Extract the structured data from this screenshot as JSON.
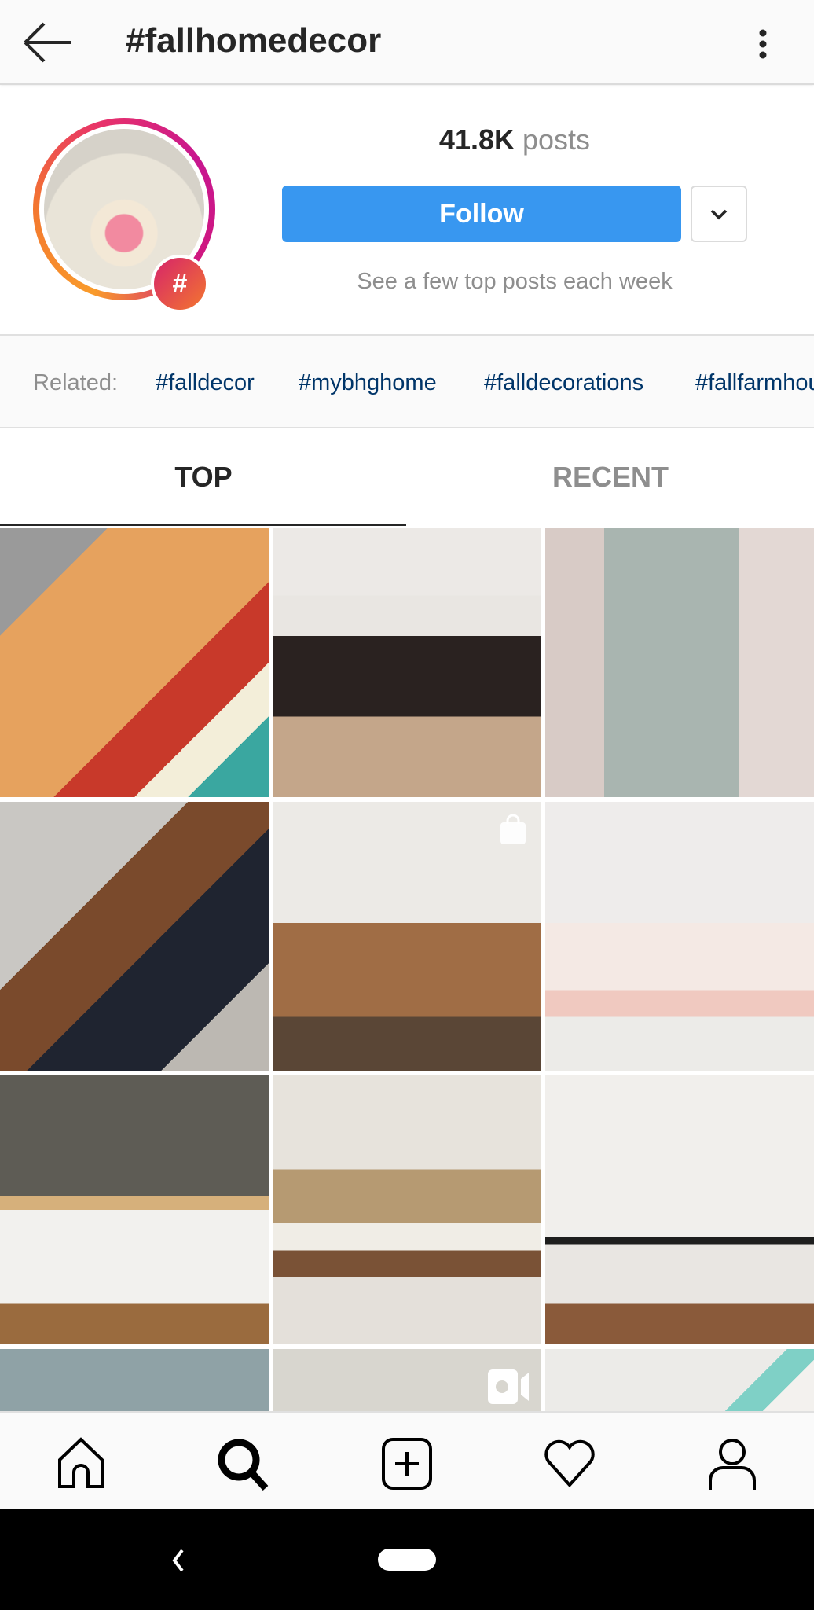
{
  "header": {
    "title": "#fallhomedecor",
    "back_icon": "arrow-left-icon",
    "more_icon": "more-vertical-icon"
  },
  "profile": {
    "posts_count": "41.8K",
    "posts_label": "posts",
    "follow_label": "Follow",
    "hint": "See a few top posts each week",
    "badge": "#",
    "accent": "#3897f0"
  },
  "related": {
    "label": "Related:",
    "tags": [
      "#falldecor",
      "#mybhghome",
      "#falldecorations",
      "#fallfarmhouse"
    ]
  },
  "tabs": [
    {
      "label": "TOP",
      "active": true
    },
    {
      "label": "RECENT",
      "active": false
    }
  ],
  "grid": [
    {
      "desc": "cat-on-blanket",
      "overlay": ""
    },
    {
      "desc": "fireplace-thankful",
      "overlay": ""
    },
    {
      "desc": "front-door-wreath",
      "overlay": ""
    },
    {
      "desc": "woman-porch-lanterns",
      "overlay": ""
    },
    {
      "desc": "apple-orchard-dining",
      "overlay": "shopping-bag-icon"
    },
    {
      "desc": "hammock-kids-corner",
      "overlay": ""
    },
    {
      "desc": "mantel-pumpkins",
      "overlay": ""
    },
    {
      "desc": "clock-console-pumpkins",
      "overlay": ""
    },
    {
      "desc": "kitchen-island",
      "overlay": ""
    },
    {
      "desc": "candy-jars-leaves",
      "overlay": ""
    },
    {
      "desc": "woman-portrait",
      "overlay": "igtv-video-icon"
    },
    {
      "desc": "mirror-red-berries",
      "overlay": ""
    }
  ],
  "bottom_nav": [
    "home-icon",
    "search-icon",
    "add-post-icon",
    "heart-icon",
    "profile-icon"
  ],
  "system_nav": [
    "system-back-icon",
    "home-pill"
  ]
}
